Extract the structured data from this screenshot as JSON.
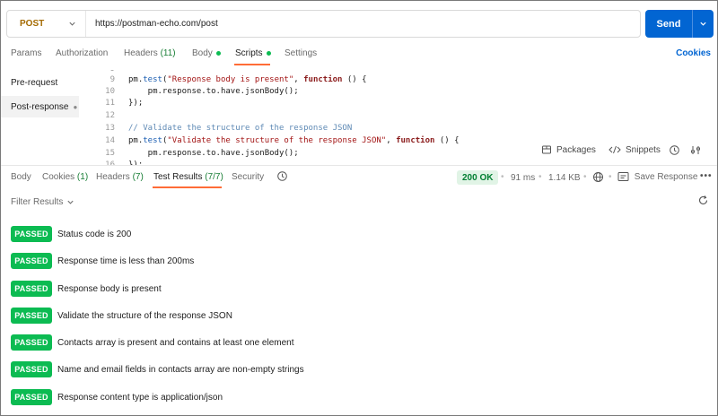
{
  "request": {
    "method": "POST",
    "url": "https://postman-echo.com/post",
    "send_label": "Send"
  },
  "request_tabs": [
    {
      "label": "Params"
    },
    {
      "label": "Authorization"
    },
    {
      "label": "Headers",
      "count": "(11)"
    },
    {
      "label": "Body"
    },
    {
      "label": "Scripts"
    },
    {
      "label": "Settings"
    }
  ],
  "cookies_link": "Cookies",
  "script_sidebar": [
    {
      "label": "Pre-request"
    },
    {
      "label": "Post-response"
    }
  ],
  "code_lines": [
    {
      "n": "9"
    },
    {
      "n": "10"
    },
    {
      "n": "11"
    },
    {
      "n": "12"
    },
    {
      "n": "13"
    },
    {
      "n": "14"
    },
    {
      "n": "15"
    },
    {
      "n": "16"
    }
  ],
  "code": {
    "l9_a": "pm.",
    "l9_b": "test",
    "l9_c": "(",
    "l9_str": "\"Response body is present\"",
    "l9_d": ", ",
    "l9_kw": "function",
    "l9_e": " () {",
    "l10": "    pm.response.to.have.jsonBody();",
    "l11": "});",
    "l13": "// Validate the structure of the response JSON",
    "l14_a": "pm.",
    "l14_b": "test",
    "l14_c": "(",
    "l14_str": "\"Validate the structure of the response JSON\"",
    "l14_d": ", ",
    "l14_kw": "function",
    "l14_e": " () {",
    "l15": "    pm.response.to.have.jsonBody();",
    "l16": "});"
  },
  "snippets_bar": {
    "packages": "Packages",
    "snippets": "Snippets"
  },
  "response_tabs": [
    {
      "label": "Body"
    },
    {
      "label": "Cookies",
      "count": "(1)"
    },
    {
      "label": "Headers",
      "count": "(7)"
    },
    {
      "label": "Test Results",
      "count": "(7/7)"
    },
    {
      "label": "Security"
    }
  ],
  "response_meta": {
    "status": "200 OK",
    "time": "91 ms",
    "size": "1.14 KB",
    "save": "Save Response"
  },
  "filter_label": "Filter Results",
  "results": [
    {
      "status": "PASSED",
      "text": "Status code is 200"
    },
    {
      "status": "PASSED",
      "text": "Response time is less than 200ms"
    },
    {
      "status": "PASSED",
      "text": "Response body is present"
    },
    {
      "status": "PASSED",
      "text": "Validate the structure of the response JSON"
    },
    {
      "status": "PASSED",
      "text": "Contacts array is present and contains at least one element"
    },
    {
      "status": "PASSED",
      "text": "Name and email fields in contacts array are non-empty strings"
    },
    {
      "status": "PASSED",
      "text": "Response content type is application/json"
    }
  ],
  "colors": {
    "accent": "#0265d2",
    "tab_underline": "#ff6c37",
    "passed": "#0cbb52",
    "method": "#a46a00"
  }
}
